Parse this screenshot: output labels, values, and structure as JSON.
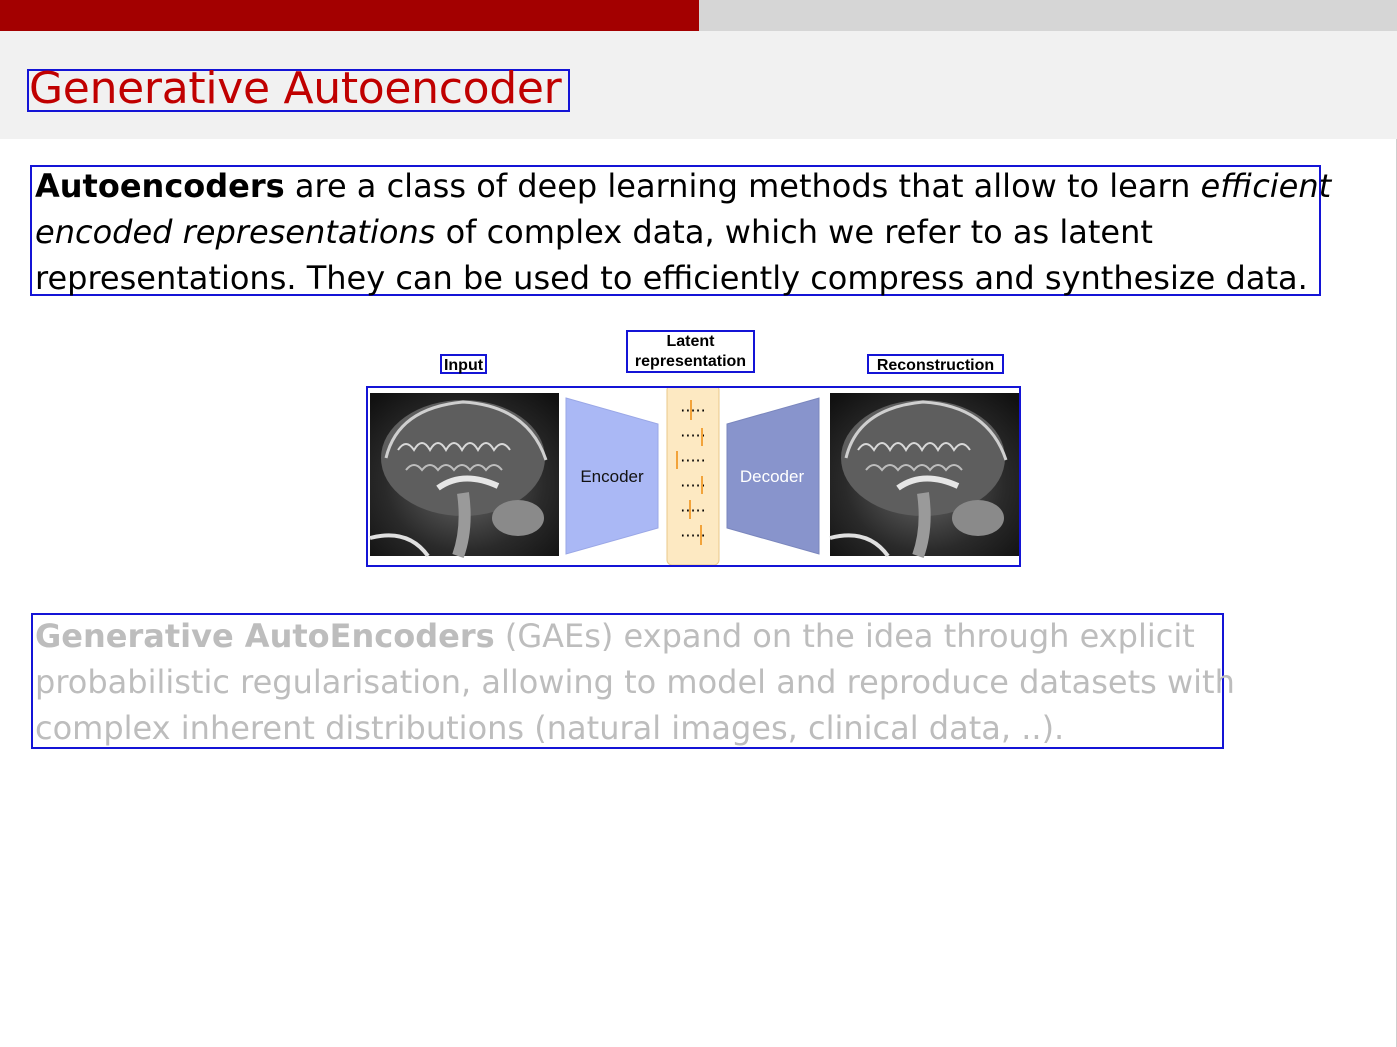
{
  "progress": {
    "fraction": 0.5,
    "fill_color": "#a30000",
    "track_color": "#d6d6d6"
  },
  "title": "Generative Autoencoder",
  "para1": {
    "l1_bold": "Autoencoders",
    "l1_text": " are a class of deep learning methods that allow to learn ",
    "l1_italic": "efficient",
    "l2_italic": "encoded representations",
    "l2_text": " of complex data, which we refer to as latent",
    "l3_text": "representations.  They can be used to efficiently compress and synthesize data."
  },
  "figure": {
    "input_label": "Input",
    "latent_label_1": "Latent",
    "latent_label_2": "representation",
    "reconstruction_label": "Reconstruction",
    "encoder_label": "Encoder",
    "decoder_label": "Decoder",
    "colors": {
      "encoder": "#aab8f5",
      "decoder": "#8894cc",
      "latent_box": "#fde9c2",
      "latent_marks": "#f2a33a"
    }
  },
  "para2": {
    "l1_bold": "Generative AutoEncoders",
    "l1_text": " (GAEs) expand on the idea through explicit",
    "l2_text": "probabilistic regularisation, allowing to model and reproduce datasets with",
    "l3_text": "complex inherent distributions (natural images, clinical data, ..)."
  }
}
